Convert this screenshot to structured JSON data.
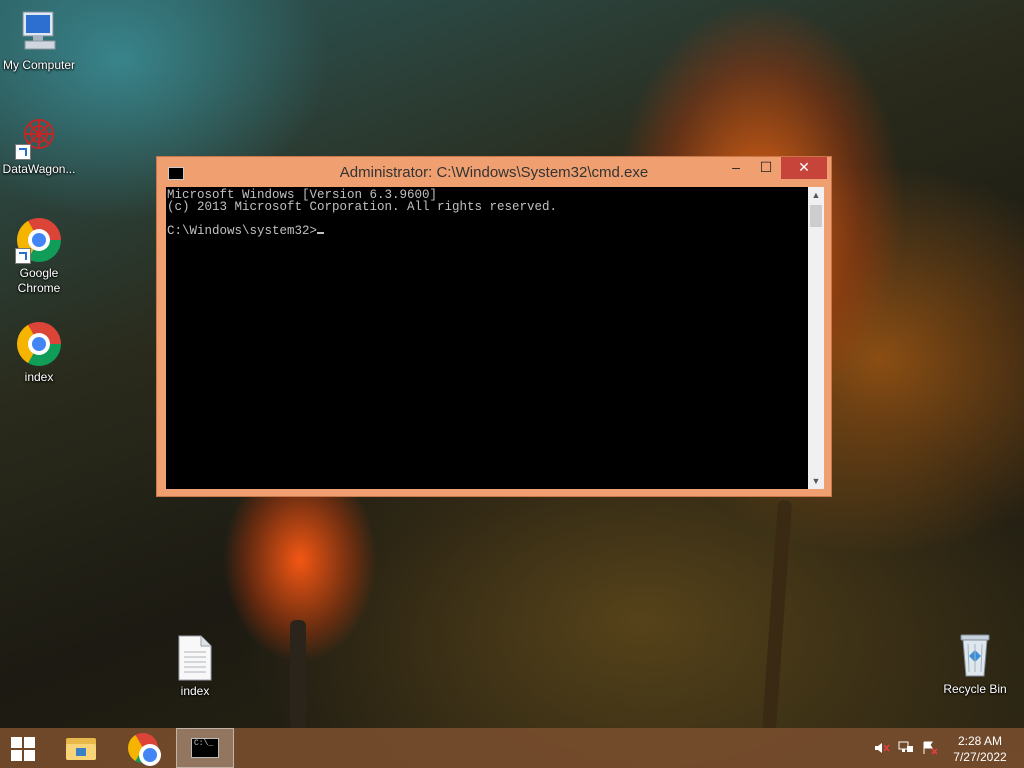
{
  "desktop": {
    "icons": [
      {
        "label": "My Computer"
      },
      {
        "label": "DataWagon..."
      },
      {
        "label": "Google Chrome"
      },
      {
        "label": "index"
      },
      {
        "label": "index"
      },
      {
        "label": "Recycle Bin"
      }
    ]
  },
  "window": {
    "title": "Administrator: C:\\Windows\\System32\\cmd.exe",
    "controls": {
      "minimize": "–",
      "maximize": "☐",
      "close": "✕"
    },
    "console_lines": [
      "Microsoft Windows [Version 6.3.9600]",
      "(c) 2013 Microsoft Corporation. All rights reserved.",
      "",
      "C:\\Windows\\system32>"
    ],
    "icon_text": "C:\\",
    "scroll": {
      "up": "▲",
      "down": "▼"
    }
  },
  "taskbar": {
    "cmd_icon_text": "C:\\_",
    "tray": {
      "time": "2:28 AM",
      "date": "7/27/2022"
    }
  },
  "colors": {
    "window_frame": "#f0a070",
    "close_button": "#c7443a",
    "taskbar": "#784e2d"
  }
}
